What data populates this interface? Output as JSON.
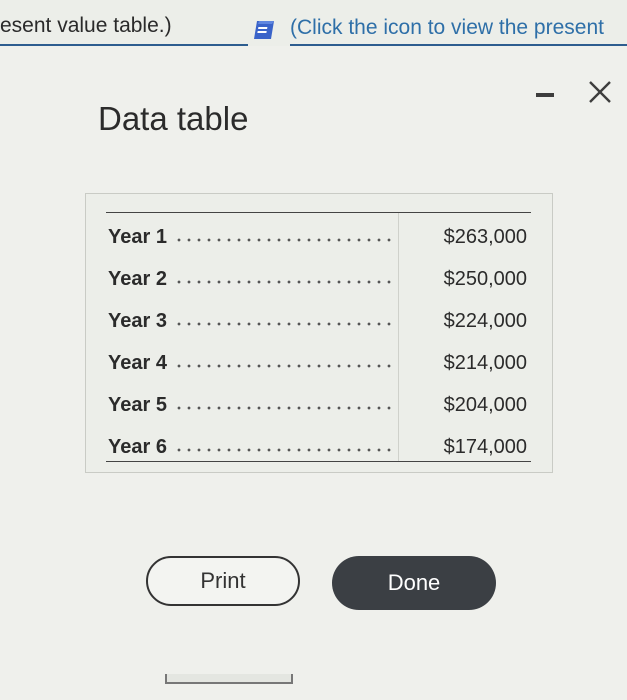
{
  "header": {
    "left_text": "esent value table.)",
    "right_text": "(Click the icon to view the present",
    "book_icon": "book-icon",
    "link_color": "#2e6fa8"
  },
  "dialog": {
    "title": "Data table",
    "minimize_icon": "minimize-icon",
    "close_icon": "close-icon",
    "rows": [
      {
        "label": "Year 1",
        "value": "$263,000"
      },
      {
        "label": "Year 2",
        "value": "$250,000"
      },
      {
        "label": "Year 3",
        "value": "$224,000"
      },
      {
        "label": "Year 4",
        "value": "$214,000"
      },
      {
        "label": "Year 5",
        "value": "$204,000"
      },
      {
        "label": "Year 6",
        "value": "$174,000"
      }
    ],
    "print_label": "Print",
    "done_label": "Done",
    "done_color": "#3b3f44"
  }
}
